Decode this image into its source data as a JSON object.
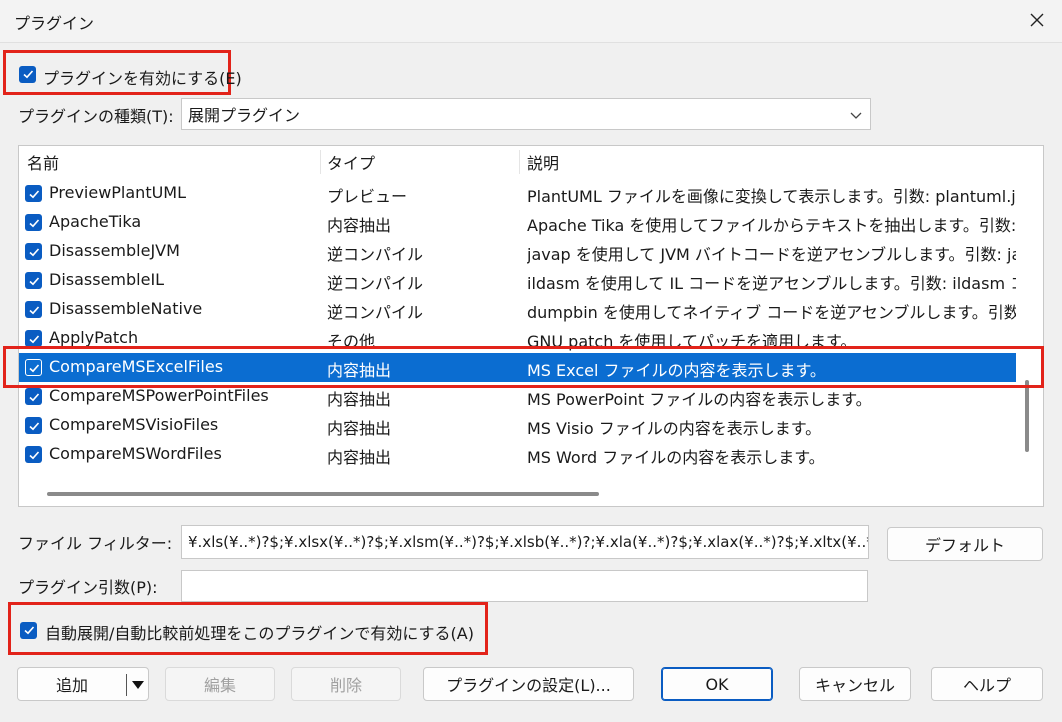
{
  "window": {
    "title": "プラグイン",
    "close_glyph": "✕"
  },
  "enable_plugins": {
    "label": "プラグインを有効にする(E)",
    "checked": true
  },
  "plugin_type": {
    "label": "プラグインの種類(T):",
    "value": "展開プラグイン"
  },
  "list": {
    "columns": [
      "名前",
      "タイプ",
      "説明"
    ],
    "rows": [
      {
        "name": "PreviewPlantUML",
        "type": "プレビュー",
        "desc": "PlantUML ファイルを画像に変換して表示します。引数: plantuml.jar"
      },
      {
        "name": "ApacheTika",
        "type": "内容抽出",
        "desc": "Apache Tika を使用してファイルからテキストを抽出します。引数: tika"
      },
      {
        "name": "DisassembleJVM",
        "type": "逆コンパイル",
        "desc": "javap を使用して JVM バイトコードを逆アセンブルします。引数: javap"
      },
      {
        "name": "DisassembleIL",
        "type": "逆コンパイル",
        "desc": "ildasm を使用して IL コードを逆アセンブルします。引数: ildasm コマン"
      },
      {
        "name": "DisassembleNative",
        "type": "逆コンパイル",
        "desc": "dumpbin を使用してネイティブ コードを逆アセンブルします。引数: dum"
      },
      {
        "name": "ApplyPatch",
        "type": "その他",
        "desc": "GNU patch を使用してパッチを適用します。"
      },
      {
        "name": "CompareMSExcelFiles",
        "type": "内容抽出",
        "desc": "MS Excel ファイルの内容を表示します。"
      },
      {
        "name": "CompareMSPowerPointFiles",
        "type": "内容抽出",
        "desc": "MS PowerPoint ファイルの内容を表示します。"
      },
      {
        "name": "CompareMSVisioFiles",
        "type": "内容抽出",
        "desc": "MS Visio ファイルの内容を表示します。"
      },
      {
        "name": "CompareMSWordFiles",
        "type": "内容抽出",
        "desc": "MS Word ファイルの内容を表示します。"
      }
    ],
    "selected_index": 6
  },
  "file_filter": {
    "label": "ファイル フィルター:",
    "value": "¥.xls(¥..*)?$;¥.xlsx(¥..*)?$;¥.xlsm(¥..*)?$;¥.xlsb(¥..*)?;¥.xla(¥..*)?$;¥.xlax(¥..*)?$;¥.xltx(¥..*",
    "default_button": "デフォルト"
  },
  "plugin_args": {
    "label": "プラグイン引数(P):",
    "value": ""
  },
  "auto_unpack": {
    "label": "自動展開/自動比較前処理をこのプラグインで有効にする(A)",
    "checked": true
  },
  "buttons": {
    "add": "追加",
    "edit": "編集",
    "delete": "削除",
    "settings": "プラグインの設定(L)...",
    "ok": "OK",
    "cancel": "キャンセル",
    "help": "ヘルプ"
  },
  "colors": {
    "accent": "#0a5cc2",
    "selection": "#0b6dd1",
    "highlight_box": "#e2231a"
  }
}
